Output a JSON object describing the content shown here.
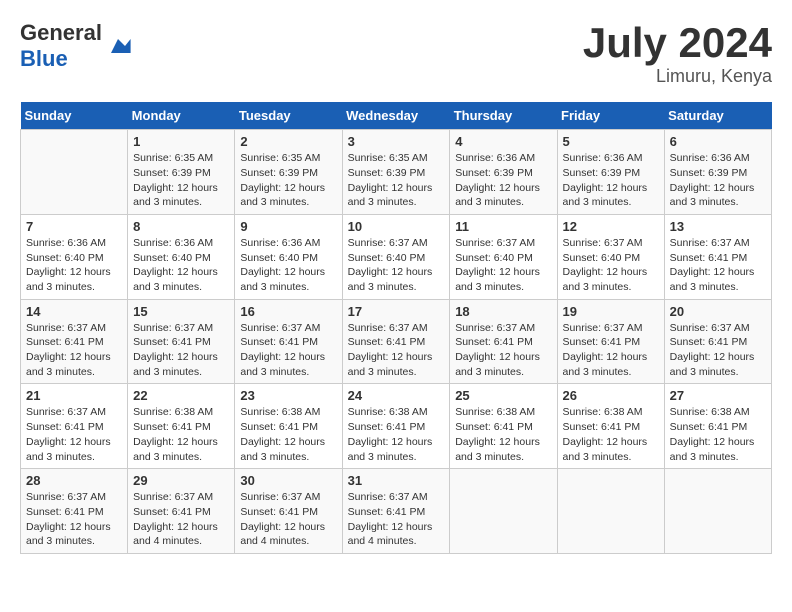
{
  "logo": {
    "text_general": "General",
    "text_blue": "Blue"
  },
  "title": "July 2024",
  "location": "Limuru, Kenya",
  "weekdays": [
    "Sunday",
    "Monday",
    "Tuesday",
    "Wednesday",
    "Thursday",
    "Friday",
    "Saturday"
  ],
  "weeks": [
    [
      {
        "day": "",
        "sunrise": "",
        "sunset": "",
        "daylight": ""
      },
      {
        "day": "1",
        "sunrise": "Sunrise: 6:35 AM",
        "sunset": "Sunset: 6:39 PM",
        "daylight": "Daylight: 12 hours and 3 minutes."
      },
      {
        "day": "2",
        "sunrise": "Sunrise: 6:35 AM",
        "sunset": "Sunset: 6:39 PM",
        "daylight": "Daylight: 12 hours and 3 minutes."
      },
      {
        "day": "3",
        "sunrise": "Sunrise: 6:35 AM",
        "sunset": "Sunset: 6:39 PM",
        "daylight": "Daylight: 12 hours and 3 minutes."
      },
      {
        "day": "4",
        "sunrise": "Sunrise: 6:36 AM",
        "sunset": "Sunset: 6:39 PM",
        "daylight": "Daylight: 12 hours and 3 minutes."
      },
      {
        "day": "5",
        "sunrise": "Sunrise: 6:36 AM",
        "sunset": "Sunset: 6:39 PM",
        "daylight": "Daylight: 12 hours and 3 minutes."
      },
      {
        "day": "6",
        "sunrise": "Sunrise: 6:36 AM",
        "sunset": "Sunset: 6:39 PM",
        "daylight": "Daylight: 12 hours and 3 minutes."
      }
    ],
    [
      {
        "day": "7",
        "sunrise": "Sunrise: 6:36 AM",
        "sunset": "Sunset: 6:40 PM",
        "daylight": "Daylight: 12 hours and 3 minutes."
      },
      {
        "day": "8",
        "sunrise": "Sunrise: 6:36 AM",
        "sunset": "Sunset: 6:40 PM",
        "daylight": "Daylight: 12 hours and 3 minutes."
      },
      {
        "day": "9",
        "sunrise": "Sunrise: 6:36 AM",
        "sunset": "Sunset: 6:40 PM",
        "daylight": "Daylight: 12 hours and 3 minutes."
      },
      {
        "day": "10",
        "sunrise": "Sunrise: 6:37 AM",
        "sunset": "Sunset: 6:40 PM",
        "daylight": "Daylight: 12 hours and 3 minutes."
      },
      {
        "day": "11",
        "sunrise": "Sunrise: 6:37 AM",
        "sunset": "Sunset: 6:40 PM",
        "daylight": "Daylight: 12 hours and 3 minutes."
      },
      {
        "day": "12",
        "sunrise": "Sunrise: 6:37 AM",
        "sunset": "Sunset: 6:40 PM",
        "daylight": "Daylight: 12 hours and 3 minutes."
      },
      {
        "day": "13",
        "sunrise": "Sunrise: 6:37 AM",
        "sunset": "Sunset: 6:41 PM",
        "daylight": "Daylight: 12 hours and 3 minutes."
      }
    ],
    [
      {
        "day": "14",
        "sunrise": "Sunrise: 6:37 AM",
        "sunset": "Sunset: 6:41 PM",
        "daylight": "Daylight: 12 hours and 3 minutes."
      },
      {
        "day": "15",
        "sunrise": "Sunrise: 6:37 AM",
        "sunset": "Sunset: 6:41 PM",
        "daylight": "Daylight: 12 hours and 3 minutes."
      },
      {
        "day": "16",
        "sunrise": "Sunrise: 6:37 AM",
        "sunset": "Sunset: 6:41 PM",
        "daylight": "Daylight: 12 hours and 3 minutes."
      },
      {
        "day": "17",
        "sunrise": "Sunrise: 6:37 AM",
        "sunset": "Sunset: 6:41 PM",
        "daylight": "Daylight: 12 hours and 3 minutes."
      },
      {
        "day": "18",
        "sunrise": "Sunrise: 6:37 AM",
        "sunset": "Sunset: 6:41 PM",
        "daylight": "Daylight: 12 hours and 3 minutes."
      },
      {
        "day": "19",
        "sunrise": "Sunrise: 6:37 AM",
        "sunset": "Sunset: 6:41 PM",
        "daylight": "Daylight: 12 hours and 3 minutes."
      },
      {
        "day": "20",
        "sunrise": "Sunrise: 6:37 AM",
        "sunset": "Sunset: 6:41 PM",
        "daylight": "Daylight: 12 hours and 3 minutes."
      }
    ],
    [
      {
        "day": "21",
        "sunrise": "Sunrise: 6:37 AM",
        "sunset": "Sunset: 6:41 PM",
        "daylight": "Daylight: 12 hours and 3 minutes."
      },
      {
        "day": "22",
        "sunrise": "Sunrise: 6:38 AM",
        "sunset": "Sunset: 6:41 PM",
        "daylight": "Daylight: 12 hours and 3 minutes."
      },
      {
        "day": "23",
        "sunrise": "Sunrise: 6:38 AM",
        "sunset": "Sunset: 6:41 PM",
        "daylight": "Daylight: 12 hours and 3 minutes."
      },
      {
        "day": "24",
        "sunrise": "Sunrise: 6:38 AM",
        "sunset": "Sunset: 6:41 PM",
        "daylight": "Daylight: 12 hours and 3 minutes."
      },
      {
        "day": "25",
        "sunrise": "Sunrise: 6:38 AM",
        "sunset": "Sunset: 6:41 PM",
        "daylight": "Daylight: 12 hours and 3 minutes."
      },
      {
        "day": "26",
        "sunrise": "Sunrise: 6:38 AM",
        "sunset": "Sunset: 6:41 PM",
        "daylight": "Daylight: 12 hours and 3 minutes."
      },
      {
        "day": "27",
        "sunrise": "Sunrise: 6:38 AM",
        "sunset": "Sunset: 6:41 PM",
        "daylight": "Daylight: 12 hours and 3 minutes."
      }
    ],
    [
      {
        "day": "28",
        "sunrise": "Sunrise: 6:37 AM",
        "sunset": "Sunset: 6:41 PM",
        "daylight": "Daylight: 12 hours and 3 minutes."
      },
      {
        "day": "29",
        "sunrise": "Sunrise: 6:37 AM",
        "sunset": "Sunset: 6:41 PM",
        "daylight": "Daylight: 12 hours and 4 minutes."
      },
      {
        "day": "30",
        "sunrise": "Sunrise: 6:37 AM",
        "sunset": "Sunset: 6:41 PM",
        "daylight": "Daylight: 12 hours and 4 minutes."
      },
      {
        "day": "31",
        "sunrise": "Sunrise: 6:37 AM",
        "sunset": "Sunset: 6:41 PM",
        "daylight": "Daylight: 12 hours and 4 minutes."
      },
      {
        "day": "",
        "sunrise": "",
        "sunset": "",
        "daylight": ""
      },
      {
        "day": "",
        "sunrise": "",
        "sunset": "",
        "daylight": ""
      },
      {
        "day": "",
        "sunrise": "",
        "sunset": "",
        "daylight": ""
      }
    ]
  ]
}
